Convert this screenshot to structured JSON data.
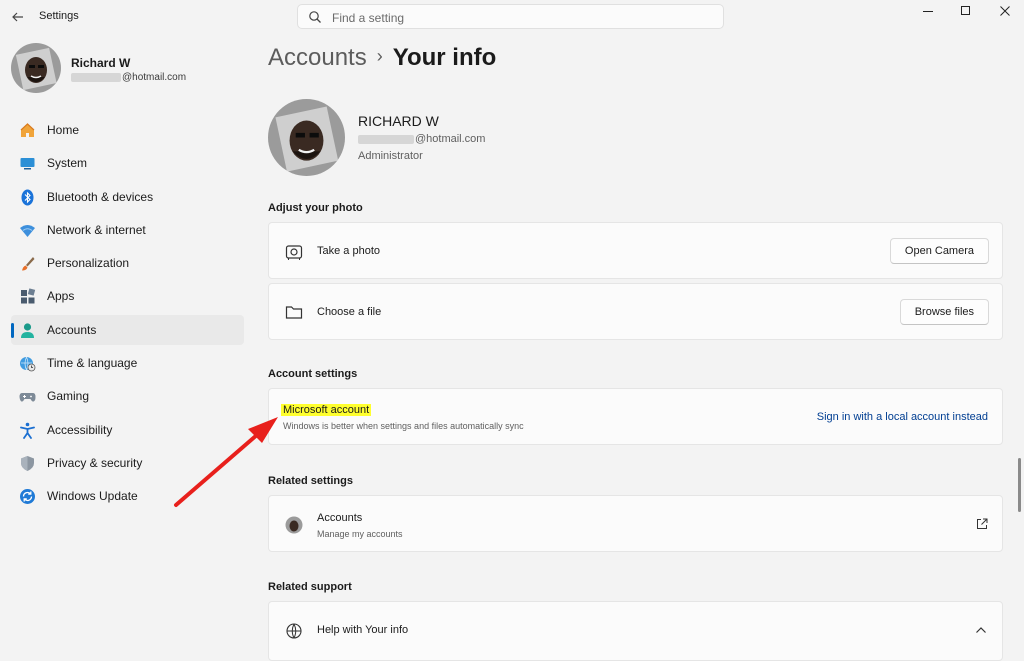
{
  "titlebar": {
    "app_title": "Settings",
    "search_placeholder": "Find a setting"
  },
  "profile": {
    "name": "Richard W",
    "email_domain": "@hotmail.com"
  },
  "nav": {
    "items": [
      {
        "label": "Home",
        "icon": "home-icon"
      },
      {
        "label": "System",
        "icon": "system-icon"
      },
      {
        "label": "Bluetooth & devices",
        "icon": "bluetooth-icon"
      },
      {
        "label": "Network & internet",
        "icon": "wifi-icon"
      },
      {
        "label": "Personalization",
        "icon": "brush-icon"
      },
      {
        "label": "Apps",
        "icon": "apps-icon"
      },
      {
        "label": "Accounts",
        "icon": "accounts-icon",
        "active": true
      },
      {
        "label": "Time & language",
        "icon": "globe-clock-icon"
      },
      {
        "label": "Gaming",
        "icon": "gamepad-icon"
      },
      {
        "label": "Accessibility",
        "icon": "accessibility-icon"
      },
      {
        "label": "Privacy & security",
        "icon": "shield-icon"
      },
      {
        "label": "Windows Update",
        "icon": "update-icon"
      }
    ]
  },
  "breadcrumb": {
    "parent": "Accounts",
    "separator": "›",
    "current": "Your info"
  },
  "user": {
    "name": "RICHARD W",
    "email_domain": "@hotmail.com",
    "role": "Administrator"
  },
  "adjust_photo": {
    "heading": "Adjust your photo",
    "take_photo_label": "Take a photo",
    "open_camera_button": "Open Camera",
    "choose_file_label": "Choose a file",
    "browse_files_button": "Browse files"
  },
  "account_settings": {
    "heading": "Account settings",
    "title": "Microsoft account",
    "subtitle": "Windows is better when settings and files automatically sync",
    "link": "Sign in with a local account instead"
  },
  "related_settings": {
    "heading": "Related settings",
    "accounts_title": "Accounts",
    "accounts_subtitle": "Manage my accounts"
  },
  "related_support": {
    "heading": "Related support",
    "help_label": "Help with Your info"
  },
  "colors": {
    "accent": "#0067c0",
    "highlight": "#ffff2e",
    "arrow": "#e8201c",
    "link": "#003e92"
  }
}
